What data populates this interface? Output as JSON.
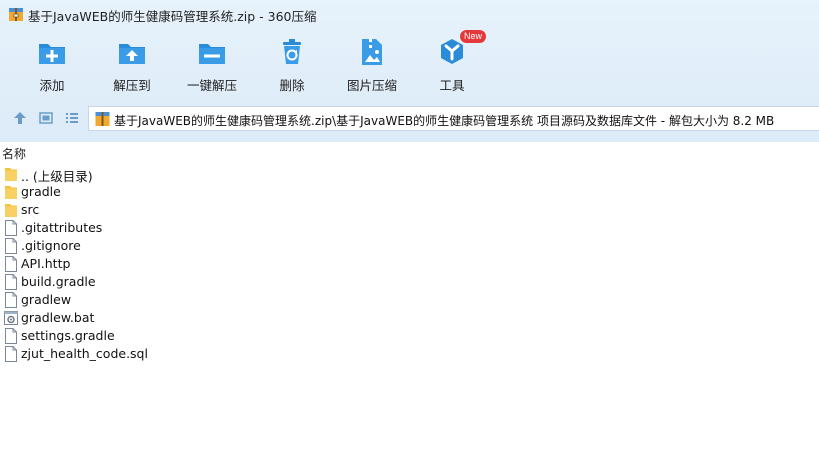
{
  "window": {
    "title": "基于JavaWEB的师生健康码管理系统.zip - 360压缩"
  },
  "toolbar": {
    "items": [
      {
        "label": "添加",
        "icon": "add-icon"
      },
      {
        "label": "解压到",
        "icon": "extract-to-icon"
      },
      {
        "label": "一键解压",
        "icon": "one-click-extract-icon"
      },
      {
        "label": "删除",
        "icon": "delete-icon"
      },
      {
        "label": "图片压缩",
        "icon": "image-compress-icon"
      },
      {
        "label": "工具",
        "icon": "tools-icon",
        "badge": "New"
      }
    ]
  },
  "address": {
    "path": "基于JavaWEB的师生健康码管理系统.zip\\基于JavaWEB的师生健康码管理系统 项目源码及数据库文件 - 解包大小为 8.2 MB"
  },
  "list": {
    "column_name": "名称",
    "files": [
      {
        "name": ".. (上级目录)",
        "type": "folder"
      },
      {
        "name": "gradle",
        "type": "folder"
      },
      {
        "name": "src",
        "type": "folder"
      },
      {
        "name": ".gitattributes",
        "type": "file"
      },
      {
        "name": ".gitignore",
        "type": "file"
      },
      {
        "name": "API.http",
        "type": "file"
      },
      {
        "name": "build.gradle",
        "type": "file"
      },
      {
        "name": "gradlew",
        "type": "file"
      },
      {
        "name": "gradlew.bat",
        "type": "bat"
      },
      {
        "name": "settings.gradle",
        "type": "file"
      },
      {
        "name": "zjut_health_code.sql",
        "type": "file"
      }
    ]
  },
  "colors": {
    "accent": "#2a8bd8",
    "toolbar_bg": "#e3eff9",
    "folder": "#f5c33b",
    "badge": "#e5383b"
  }
}
